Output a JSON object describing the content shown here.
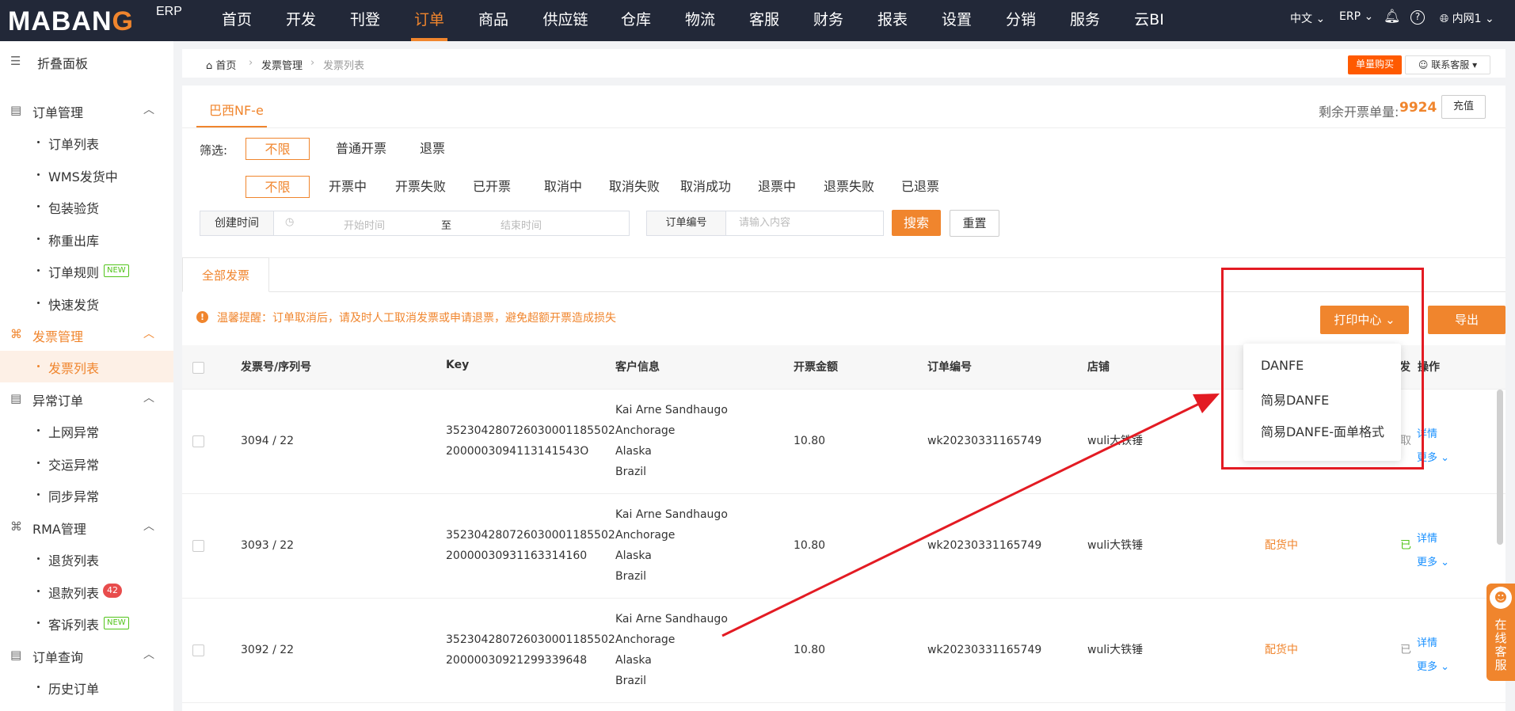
{
  "topbar": {
    "logo_pre": "MABAN",
    "logo_o": "G",
    "logo_sub": "ERP",
    "nav": [
      "首页",
      "开发",
      "刊登",
      "订单",
      "商品",
      "供应链",
      "仓库",
      "物流",
      "客服",
      "财务",
      "报表",
      "设置",
      "分销",
      "服务",
      "云BI"
    ],
    "active_nav": "订单",
    "lang": "中文",
    "erp": "ERP",
    "user": "内网1"
  },
  "sidebar": {
    "collapse_label": "折叠面板",
    "groups": [
      {
        "label": "订单管理",
        "items": [
          "订单列表",
          "WMS发货中",
          "包装验货",
          "称重出库",
          "订单规则",
          "快速发货"
        ]
      },
      {
        "label": "发票管理",
        "items": [
          "发票列表"
        ]
      },
      {
        "label": "异常订单",
        "items": [
          "上网异常",
          "交运异常",
          "同步异常"
        ]
      },
      {
        "label": "RMA管理",
        "items": [
          "退货列表",
          "退款列表",
          "客诉列表"
        ]
      },
      {
        "label": "订单查询",
        "items": [
          "历史订单"
        ]
      }
    ],
    "badges": {
      "new": "NEW",
      "refund_count": "42"
    }
  },
  "breadcrumb": {
    "home": "首页",
    "level1": "发票管理",
    "level2": "发票列表",
    "buy": "单量购买",
    "service": "联系客服"
  },
  "main": {
    "tab": "巴西NF-e",
    "remaining_label": "剩余开票单量:",
    "remaining_value": "9924",
    "recharge": "充值",
    "filter_label": "筛选:",
    "filter_row1": [
      "不限",
      "普通开票",
      "退票"
    ],
    "filter_row2": [
      "不限",
      "开票中",
      "开票失败",
      "已开票",
      "取消中",
      "取消失败",
      "取消成功",
      "退票中",
      "退票失败",
      "已退票"
    ],
    "search": {
      "date_label": "创建时间",
      "start_placeholder": "开始时间",
      "to": "至",
      "end_placeholder": "结束时间",
      "order_label": "订单编号",
      "order_placeholder": "请输入内容",
      "search_btn": "搜索",
      "reset_btn": "重置"
    },
    "subtab": "全部发票",
    "notice": "温馨提醒：订单取消后，请及时人工取消发票或申请退票，避免超额开票造成损失",
    "print_center": "打印中心",
    "export": "导出",
    "dropdown": [
      "DANFE",
      "简易DANFE",
      "简易DANFE-面单格式"
    ],
    "columns": [
      "发票号/序列号",
      "Key",
      "客户信息",
      "开票金额",
      "订单编号",
      "店铺",
      "发",
      "操作"
    ],
    "rows": [
      {
        "invoice": "3094 / 22",
        "key1": "352304280726030001185502",
        "key2": "2000003094113141543O",
        "cust1": "Kai Arne Sandhaugo",
        "cust2": "Anchorage",
        "cust3": "Alaska",
        "cust4": "Brazil",
        "amount": "10.80",
        "order": "wk20230331165749",
        "shop": "wuli大铁锤",
        "status": "",
        "status2": "取",
        "detail": "详情",
        "more": "更多"
      },
      {
        "invoice": "3093 / 22",
        "key1": "352304280726030001185502",
        "key2": "20000030931163314160",
        "cust1": "Kai Arne Sandhaugo",
        "cust2": "Anchorage",
        "cust3": "Alaska",
        "cust4": "Brazil",
        "amount": "10.80",
        "order": "wk20230331165749",
        "shop": "wuli大铁锤",
        "status": "配货中",
        "status2": "已",
        "detail": "详情",
        "more": "更多"
      },
      {
        "invoice": "3092 / 22",
        "key1": "352304280726030001185502",
        "key2": "20000030921299339648",
        "cust1": "Kai Arne Sandhaugo",
        "cust2": "Anchorage",
        "cust3": "Alaska",
        "cust4": "Brazil",
        "amount": "10.80",
        "order": "wk20230331165749",
        "shop": "wuli大铁锤",
        "status": "配货中",
        "status2": "已",
        "detail": "详情",
        "more": "更多"
      }
    ]
  },
  "float_service": "在线客服"
}
